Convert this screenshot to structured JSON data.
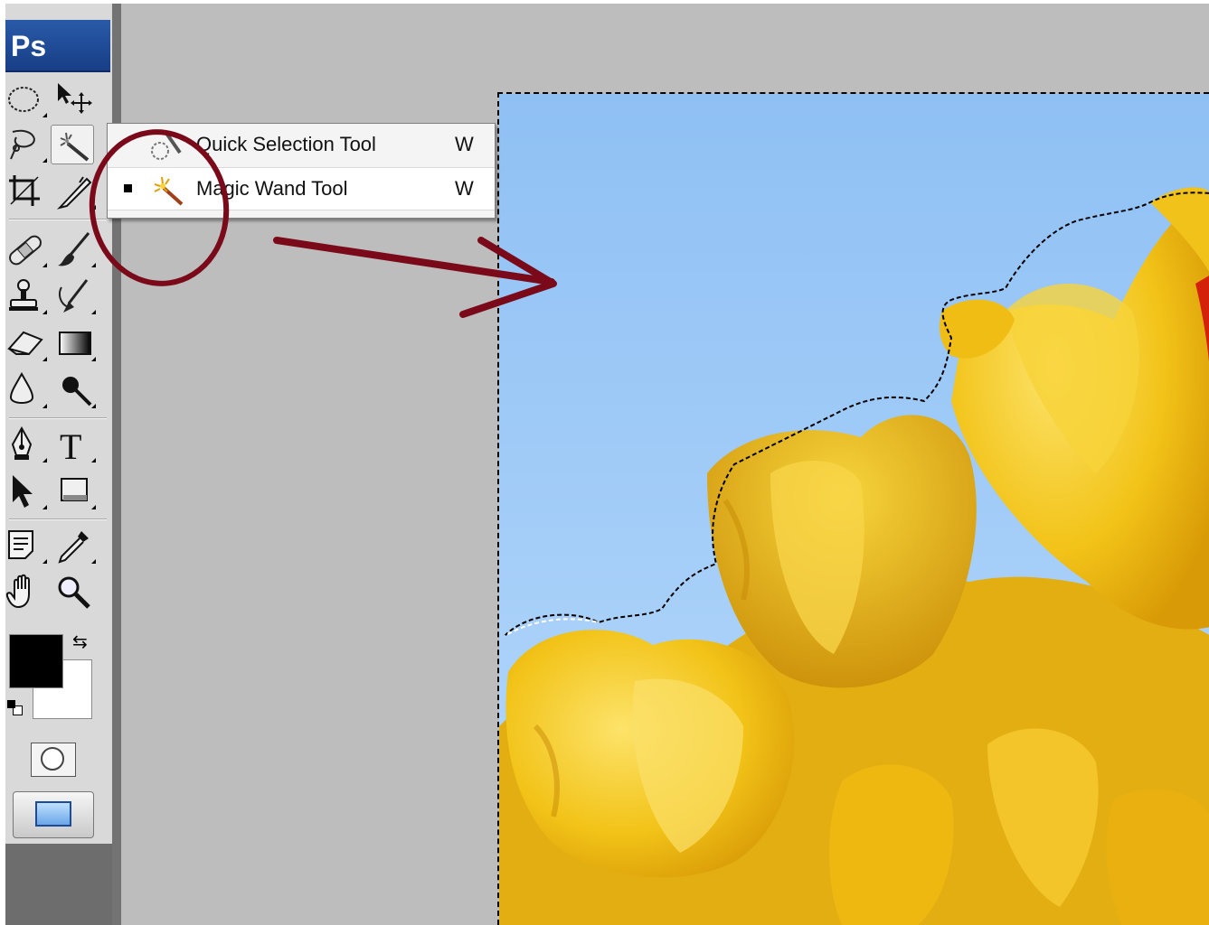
{
  "app": {
    "logo_text": "Ps"
  },
  "toolbox": {
    "tools": [
      {
        "name": "elliptical-marquee-tool",
        "icon": "ellipse-marquee-icon"
      },
      {
        "name": "move-tool",
        "icon": "move-icon"
      },
      {
        "name": "lasso-tool",
        "icon": "lasso-icon"
      },
      {
        "name": "magic-wand-tool",
        "icon": "magic-wand-icon",
        "active": true
      },
      {
        "name": "crop-tool",
        "icon": "crop-icon"
      },
      {
        "name": "slice-tool",
        "icon": "slice-knife-icon"
      },
      {
        "name": "healing-brush-tool",
        "icon": "bandage-icon"
      },
      {
        "name": "brush-tool",
        "icon": "brush-icon"
      },
      {
        "name": "clone-stamp-tool",
        "icon": "stamp-icon"
      },
      {
        "name": "history-brush-tool",
        "icon": "history-brush-icon"
      },
      {
        "name": "eraser-tool",
        "icon": "eraser-icon"
      },
      {
        "name": "gradient-tool",
        "icon": "gradient-icon"
      },
      {
        "name": "blur-tool",
        "icon": "drop-icon"
      },
      {
        "name": "dodge-tool",
        "icon": "dodge-icon"
      },
      {
        "name": "pen-tool",
        "icon": "pen-nib-icon"
      },
      {
        "name": "type-tool",
        "icon": "type-icon",
        "glyph": "T"
      },
      {
        "name": "path-selection-tool",
        "icon": "arrow-cursor-icon"
      },
      {
        "name": "rectangle-tool",
        "icon": "rectangle-icon"
      },
      {
        "name": "notes-tool",
        "icon": "notes-icon"
      },
      {
        "name": "eyedropper-tool",
        "icon": "eyedropper-icon"
      },
      {
        "name": "hand-tool",
        "icon": "hand-icon"
      },
      {
        "name": "zoom-tool",
        "icon": "magnifier-icon"
      }
    ],
    "foreground_color": "#000000",
    "background_color": "#ffffff"
  },
  "flyout": {
    "items": [
      {
        "label": "Quick Selection Tool",
        "shortcut": "W",
        "icon": "quick-selection-icon",
        "selected": false
      },
      {
        "label": "Magic Wand Tool",
        "shortcut": "W",
        "icon": "magic-wand-icon",
        "selected": true
      }
    ]
  },
  "annotation": {
    "color": "#7a0a1a"
  },
  "canvas": {
    "sky_color": "#9cc8f4",
    "flower_color": "#f2c318"
  }
}
